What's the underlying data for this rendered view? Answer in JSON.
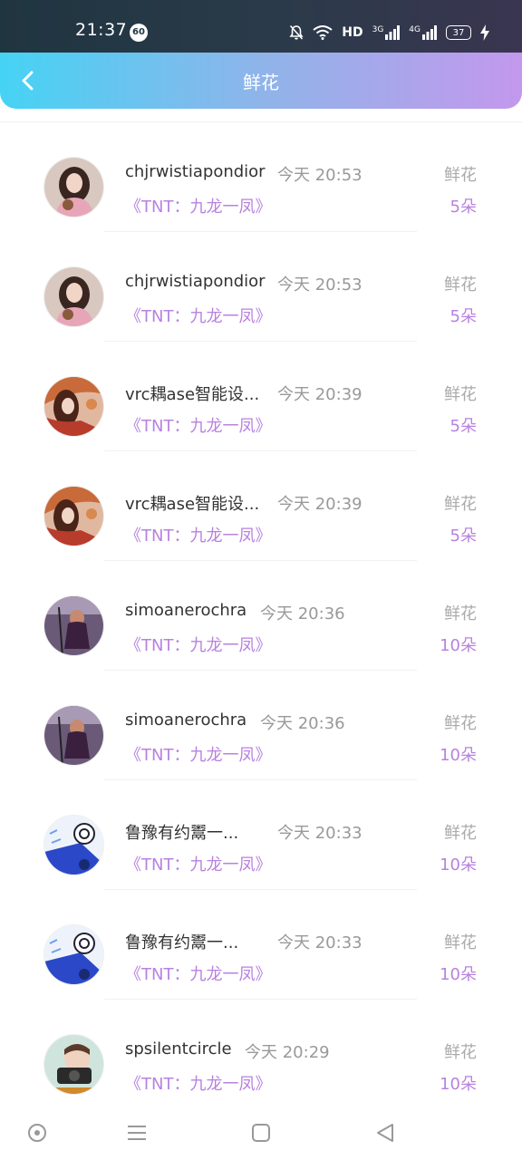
{
  "status_bar": {
    "time": "21:37",
    "badge": "60",
    "network_label": "HD",
    "signal1_label": "3G",
    "signal2_label": "4G",
    "battery": "37"
  },
  "app_bar": {
    "title": "鲜花"
  },
  "records": [
    {
      "name": "chjrwistiapondior",
      "time": "今天 20:53",
      "event": "《TNT：九龙一凤》",
      "gift": "鲜花",
      "count": "5朵",
      "avatar": "girl-pink"
    },
    {
      "name": "chjrwistiapondior",
      "time": "今天 20:53",
      "event": "《TNT：九龙一凤》",
      "gift": "鲜花",
      "count": "5朵",
      "avatar": "girl-pink"
    },
    {
      "name": "vrc耦ase智能设...",
      "time": "今天 20:39",
      "event": "《TNT：九龙一凤》",
      "gift": "鲜花",
      "count": "5朵",
      "avatar": "red-autumn"
    },
    {
      "name": "vrc耦ase智能设...",
      "time": "今天 20:39",
      "event": "《TNT：九龙一凤》",
      "gift": "鲜花",
      "count": "5朵",
      "avatar": "red-autumn"
    },
    {
      "name": "simoanerochra",
      "time": "今天 20:36",
      "event": "《TNT：九龙一凤》",
      "gift": "鲜花",
      "count": "10朵",
      "avatar": "purple-figure"
    },
    {
      "name": "simoanerochra",
      "time": "今天 20:36",
      "event": "《TNT：九龙一凤》",
      "gift": "鲜花",
      "count": "10朵",
      "avatar": "purple-figure"
    },
    {
      "name": "鲁豫有约鬻一...",
      "time": "今天 20:33",
      "event": "《TNT：九龙一凤》",
      "gift": "鲜花",
      "count": "10朵",
      "avatar": "blue-anime"
    },
    {
      "name": "鲁豫有约鬻一...",
      "time": "今天 20:33",
      "event": "《TNT：九龙一凤》",
      "gift": "鲜花",
      "count": "10朵",
      "avatar": "blue-anime"
    },
    {
      "name": "spsilentcircle",
      "time": "今天 20:29",
      "event": "《TNT：九龙一凤》",
      "gift": "鲜花",
      "count": "10朵",
      "avatar": "teal-camera"
    }
  ],
  "colors": {
    "accent": "#b882e0",
    "header_start": "#45d3f4",
    "header_end": "#c398ec"
  }
}
